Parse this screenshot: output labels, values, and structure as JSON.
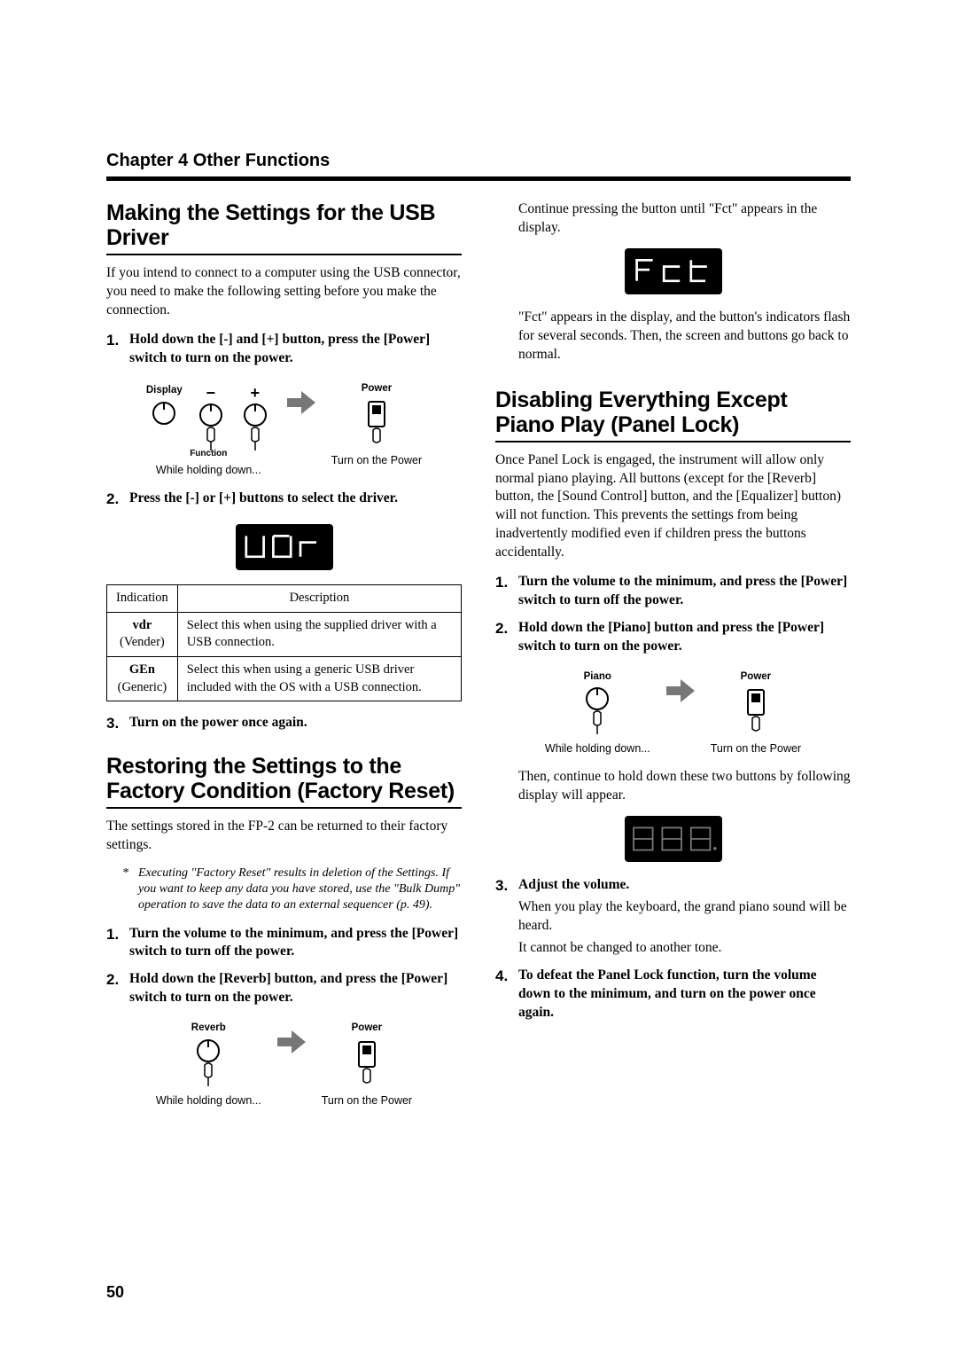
{
  "chapter": "Chapter 4 Other Functions",
  "page_number": "50",
  "left": {
    "sec1": {
      "title": "Making the Settings for the USB Driver",
      "intro": "If you intend to connect to a computer using the USB connector, you need to make the following setting before you make the connection.",
      "step1": "Hold down the [-] and [+] button, press the [Power] switch to turn on the power.",
      "diag1": {
        "display": "Display",
        "function": "Function",
        "minus": "−",
        "plus": "+",
        "power": "Power",
        "hold": "While holding down...",
        "turn": "Turn on the Power"
      },
      "step2": "Press the [-] or [+] buttons to select the driver.",
      "table": {
        "h1": "Indication",
        "h2": "Description",
        "r1a": "vdr",
        "r1b": "(Vender)",
        "r1d": "Select this when using the supplied driver with a USB connection.",
        "r2a": "GEn",
        "r2b": "(Generic)",
        "r2d": "Select this when using a generic USB driver included with the OS with a USB connection."
      },
      "step3": "Turn on the power once again."
    },
    "sec2": {
      "title": "Restoring the Settings to the Factory Condition (Factory Reset)",
      "intro": "The settings stored in the FP-2 can be returned to their factory settings.",
      "note": "Executing \"Factory Reset\" results in deletion of the Settings. If you want to keep any data you have stored, use the \"Bulk Dump\" operation to save the data to an external sequencer (p. 49).",
      "step1": "Turn the volume to the minimum, and press the [Power] switch to turn off the power.",
      "step2": "Hold down the [Reverb] button, and press the [Power] switch to turn on the power.",
      "diag": {
        "reverb": "Reverb",
        "power": "Power",
        "hold": "While holding down...",
        "turn": "Turn on the Power"
      }
    }
  },
  "right": {
    "cont1": "Continue pressing the button until \"Fct\" appears in the display.",
    "cont2": "\"Fct\" appears in the display, and the button's indicators flash for several seconds. Then, the screen and buttons go back to normal.",
    "sec3": {
      "title": "Disabling Everything Except Piano Play (Panel Lock)",
      "intro": "Once Panel Lock is engaged, the instrument will allow only normal piano playing. All buttons (except for the [Reverb] button, the [Sound Control] button, and the [Equalizer] button) will not function. This prevents the settings from being inadvertently modified even if children press the buttons accidentally.",
      "step1": "Turn the volume to the minimum, and press the [Power] switch to turn off the power.",
      "step2": "Hold down the [Piano] button and press the [Power] switch to turn on the power.",
      "diag": {
        "piano": "Piano",
        "power": "Power",
        "hold": "While holding down...",
        "turn": "Turn on the Power"
      },
      "after_diag": "Then, continue to hold down these two buttons by following display will appear.",
      "step3": "Adjust the volume.",
      "step3a": "When you play the keyboard, the grand piano sound will be heard.",
      "step3b": "It cannot be changed to another tone.",
      "step4": "To defeat the Panel Lock function, turn the volume down to the minimum, and turn on the power once again."
    }
  }
}
